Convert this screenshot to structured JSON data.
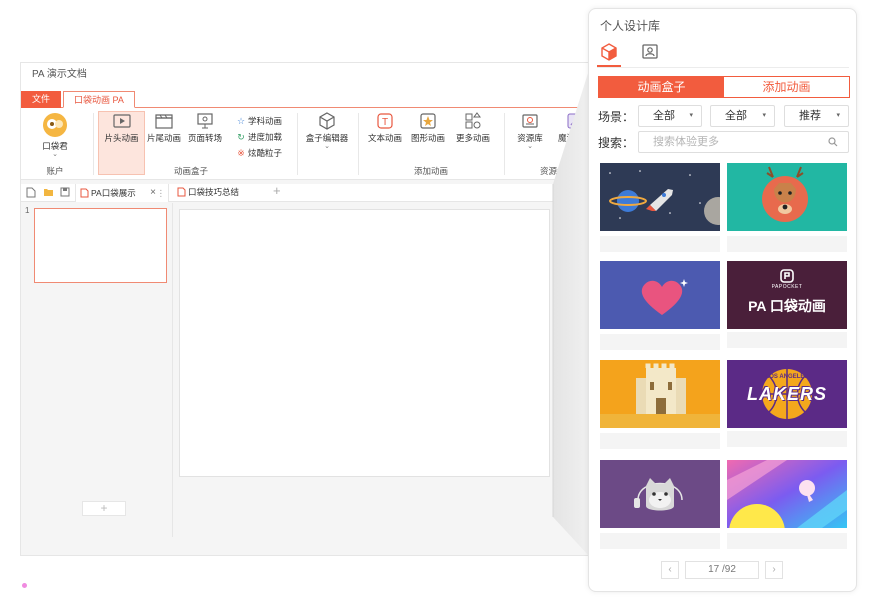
{
  "app": {
    "title": "PA 演示文档",
    "ribbon_tabs": [
      "文件",
      "口袋动画 PA"
    ],
    "ribbon": {
      "account_button": "口袋君",
      "account_group": "账户",
      "box_group_buttons": [
        "片头动画",
        "片尾动画",
        "页面转场"
      ],
      "small_items": [
        "学科动画",
        "进度加载",
        "炫酷粒子"
      ],
      "box_group": "动画盒子",
      "box_editor": "盒子编辑器",
      "add_group_buttons": [
        "文本动画",
        "图形动画",
        "更多动画"
      ],
      "add_group": "添加动画",
      "resource_buttons": [
        "资源库",
        "魔法设计"
      ],
      "resource_group": "资源盒子"
    },
    "doc_tabs": [
      "PA口袋展示",
      "口袋技巧总结"
    ],
    "slide_number": "1",
    "add_slide": "+"
  },
  "panel": {
    "title": "个人设计库",
    "segments": [
      "动画盒子",
      "添加动画"
    ],
    "scene_label": "场景：",
    "filters": [
      "全部",
      "全部",
      "推荐"
    ],
    "search_label": "搜索：",
    "search_placeholder": "搜索体验更多",
    "cards": [
      {
        "name": "rocket-planet"
      },
      {
        "name": "deer"
      },
      {
        "name": "heart"
      },
      {
        "name": "papocket-logo",
        "logo_small": "PAPOCKET",
        "logo_big": "PA 口袋动画"
      },
      {
        "name": "castle"
      },
      {
        "name": "lakers",
        "logo_top": "LOS ANGELES",
        "logo_main": "LAKERS"
      },
      {
        "name": "cat-headphones"
      },
      {
        "name": "colorful-shapes"
      }
    ],
    "pager": {
      "current": "17",
      "total": "/92",
      "prev": "‹",
      "next": "›"
    }
  },
  "colors": {
    "accent": "#f25c3e",
    "ribbon_hover": "#fde5dd"
  }
}
